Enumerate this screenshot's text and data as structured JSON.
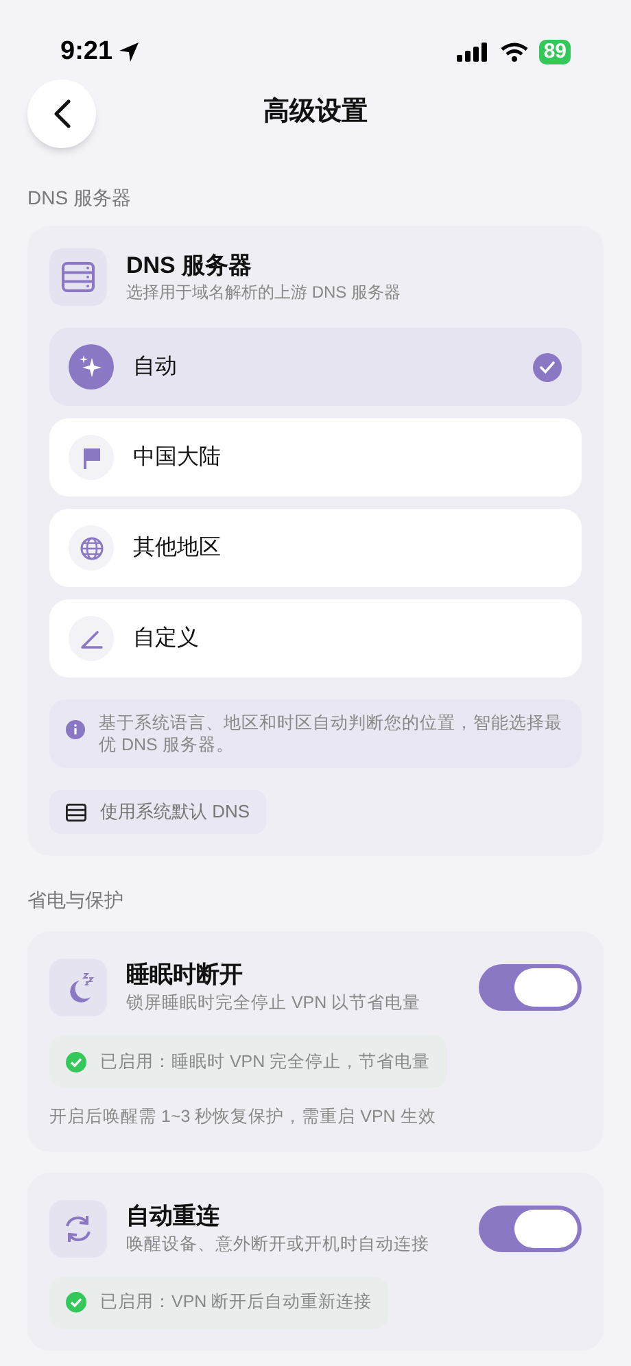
{
  "status_bar": {
    "time": "9:21",
    "battery": "89"
  },
  "header": {
    "title": "高级设置"
  },
  "dns_section": {
    "label": "DNS 服务器",
    "title": "DNS 服务器",
    "subtitle": "选择用于域名解析的上游 DNS 服务器",
    "options": [
      {
        "kind": "sparkle",
        "label": "自动",
        "selected": true
      },
      {
        "kind": "flag",
        "label": "中国大陆",
        "selected": false
      },
      {
        "kind": "globe",
        "label": "其他地区",
        "selected": false
      },
      {
        "kind": "pen",
        "label": "自定义",
        "selected": false
      }
    ],
    "info": "基于系统语言、地区和时区自动判断您的位置，智能选择最优 DNS 服务器。",
    "system_button": "使用系统默认 DNS"
  },
  "power_section": {
    "label": "省电与保护",
    "items": [
      {
        "kind": "sleep",
        "title": "睡眠时断开",
        "subtitle": "锁屏睡眠时完全停止 VPN 以节省电量",
        "on": true,
        "status": "已启用：睡眠时 VPN 完全停止，节省电量",
        "note": "开启后唤醒需 1~3 秒恢复保护，需重启 VPN 生效"
      },
      {
        "kind": "reconnect",
        "title": "自动重连",
        "subtitle": "唤醒设备、意外断开或开机时自动连接",
        "on": true,
        "status": "已启用：VPN 断开后自动重新连接"
      }
    ]
  }
}
